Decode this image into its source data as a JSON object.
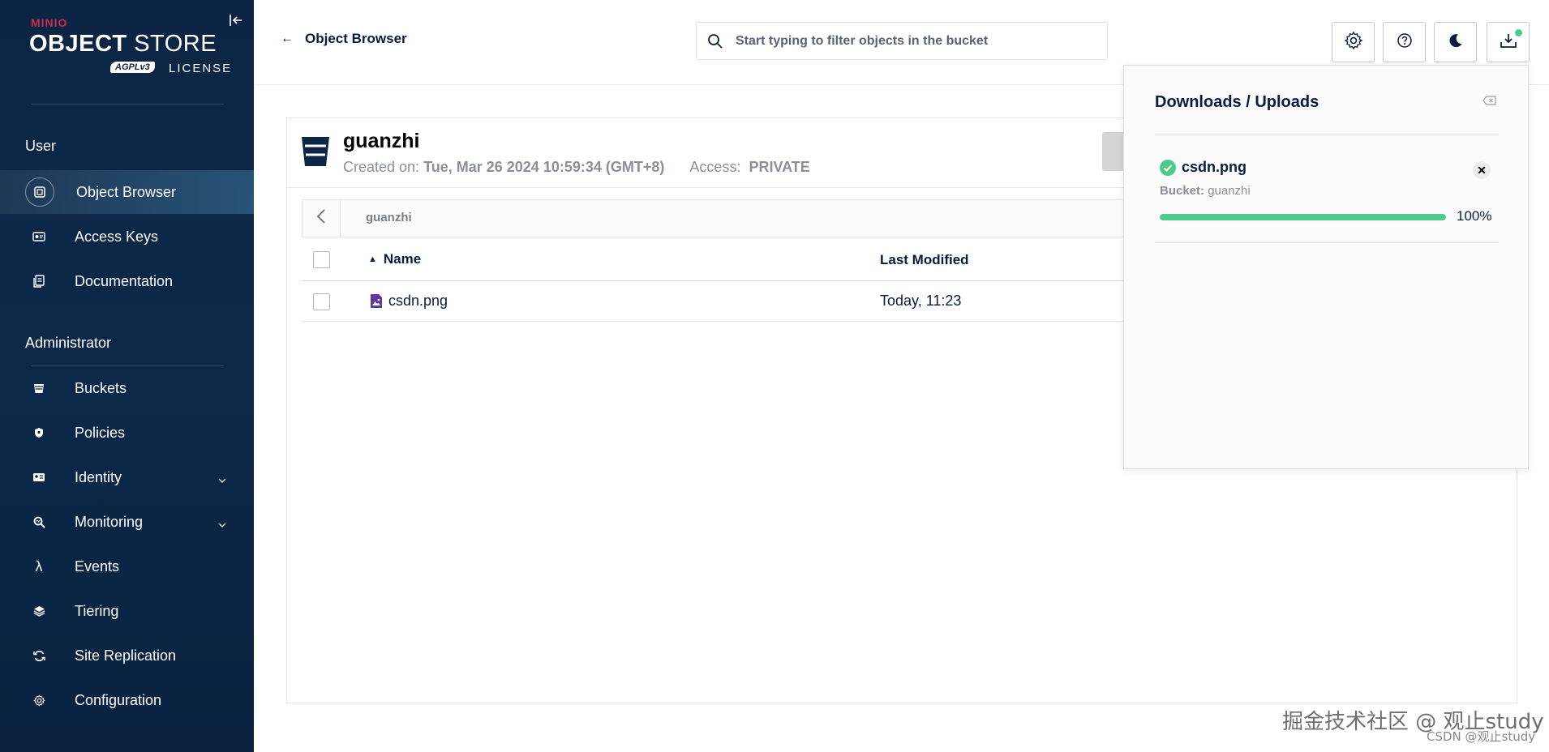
{
  "sidebar": {
    "logo": {
      "brand": "MINIO",
      "product_bold": "OBJECT",
      "product_light": "STORE",
      "badge": "AGPLv3",
      "license": "LICENSE"
    },
    "sections": {
      "user": "User",
      "admin": "Administrator"
    },
    "user_items": [
      {
        "label": "Object Browser",
        "icon": "object-browser-icon",
        "active": true
      },
      {
        "label": "Access Keys",
        "icon": "access-keys-icon"
      },
      {
        "label": "Documentation",
        "icon": "documentation-icon"
      }
    ],
    "admin_items": [
      {
        "label": "Buckets",
        "icon": "buckets-icon"
      },
      {
        "label": "Policies",
        "icon": "policies-icon"
      },
      {
        "label": "Identity",
        "icon": "identity-icon",
        "expandable": true
      },
      {
        "label": "Monitoring",
        "icon": "monitoring-icon",
        "expandable": true
      },
      {
        "label": "Events",
        "icon": "lambda-icon"
      },
      {
        "label": "Tiering",
        "icon": "tiering-icon"
      },
      {
        "label": "Site Replication",
        "icon": "site-replication-icon"
      },
      {
        "label": "Configuration",
        "icon": "configuration-icon"
      }
    ]
  },
  "header": {
    "back_label": "Object Browser",
    "search_placeholder": "Start typing to filter objects in the bucket"
  },
  "bucket": {
    "name": "guanzhi",
    "created_label": "Created on:",
    "created_value": "Tue, Mar 26 2024 10:59:34 (GMT+8)",
    "access_label": "Access:",
    "access_value": "PRIVATE",
    "breadcrumb": "guanzhi"
  },
  "table": {
    "columns": {
      "name": "Name",
      "last_modified": "Last Modified"
    },
    "rows": [
      {
        "name": "csdn.png",
        "last_modified": "Today, 11:23"
      }
    ]
  },
  "downloads": {
    "title": "Downloads / Uploads",
    "item": {
      "name": "csdn.png",
      "bucket_label": "Bucket:",
      "bucket_value": "guanzhi",
      "progress": 100,
      "progress_label": "100%"
    }
  },
  "colors": {
    "sidebar_bg": "#0c2545",
    "accent_green": "#4ccb8d",
    "brand_red": "#c72e49",
    "text_dark": "#081c42"
  },
  "watermark": {
    "line1": "掘金技术社区 @ 观止study",
    "line2": "CSDN @观止study"
  }
}
